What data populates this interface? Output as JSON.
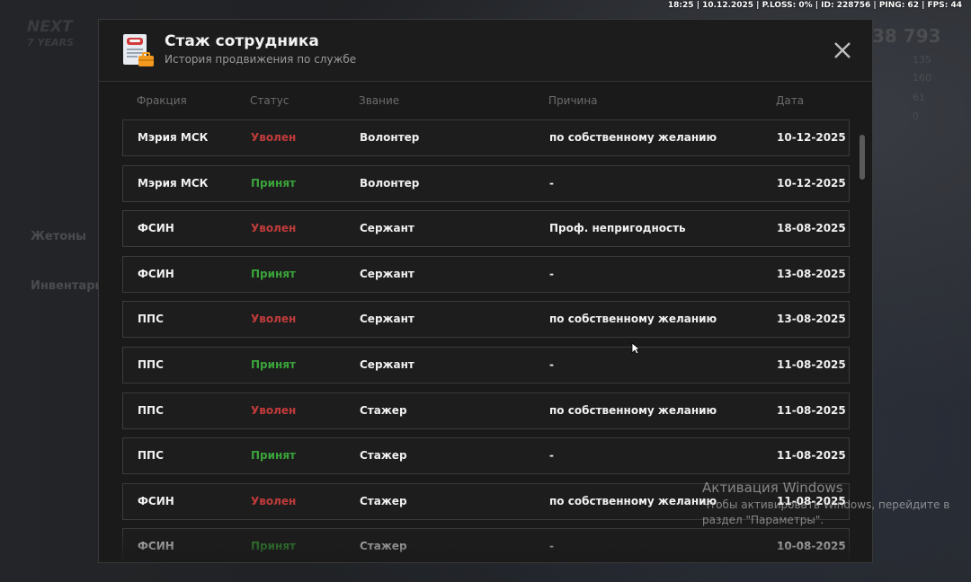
{
  "hud": {
    "text": "18:25 | 10.12.2025 | P.LOSS: 0% | ID: 228756 | PING: 62 | FPS: 44"
  },
  "background": {
    "logo_line1": "NEXT",
    "logo_line2": "7 YEARS",
    "side_items": [
      "Жетоны",
      "Инвентарь"
    ],
    "right_number": "38 793",
    "right_stats": [
      "135",
      "160",
      "61",
      "0"
    ]
  },
  "modal": {
    "title": "Стаж сотрудника",
    "subtitle": "История продвижения по службе",
    "columns": {
      "faction": "Фракция",
      "status": "Статус",
      "rank": "Звание",
      "reason": "Причина",
      "date": "Дата"
    },
    "rows": [
      {
        "faction": "Мэрия МСК",
        "status": "Уволен",
        "status_type": "fired",
        "rank": "Волонтер",
        "reason": "по собственному желанию",
        "date": "10-12-2025"
      },
      {
        "faction": "Мэрия МСК",
        "status": "Принят",
        "status_type": "hired",
        "rank": "Волонтер",
        "reason": "-",
        "date": "10-12-2025"
      },
      {
        "faction": "ФСИН",
        "status": "Уволен",
        "status_type": "fired",
        "rank": "Сержант",
        "reason": "Проф. непригодность",
        "date": "18-08-2025"
      },
      {
        "faction": "ФСИН",
        "status": "Принят",
        "status_type": "hired",
        "rank": "Сержант",
        "reason": "-",
        "date": "13-08-2025"
      },
      {
        "faction": "ППС",
        "status": "Уволен",
        "status_type": "fired",
        "rank": "Сержант",
        "reason": "по собственному желанию",
        "date": "13-08-2025"
      },
      {
        "faction": "ППС",
        "status": "Принят",
        "status_type": "hired",
        "rank": "Сержант",
        "reason": "-",
        "date": "11-08-2025"
      },
      {
        "faction": "ППС",
        "status": "Уволен",
        "status_type": "fired",
        "rank": "Стажер",
        "reason": "по собственному желанию",
        "date": "11-08-2025"
      },
      {
        "faction": "ППС",
        "status": "Принят",
        "status_type": "hired",
        "rank": "Стажер",
        "reason": "-",
        "date": "11-08-2025"
      },
      {
        "faction": "ФСИН",
        "status": "Уволен",
        "status_type": "fired",
        "rank": "Стажер",
        "reason": "по собственному желанию",
        "date": "11-08-2025"
      },
      {
        "faction": "ФСИН",
        "status": "Принят",
        "status_type": "hired",
        "rank": "Стажер",
        "reason": "-",
        "date": "10-08-2025"
      }
    ],
    "colors": {
      "fired": "#c13b3b",
      "hired": "#3aa33a"
    },
    "icons": {
      "header": "document-briefcase-icon",
      "close": "close-icon"
    }
  },
  "watermark": {
    "title": "Активация Windows",
    "line1": "Чтобы активировать Windows, перейдите в",
    "line2": "раздел \"Параметры\"."
  }
}
